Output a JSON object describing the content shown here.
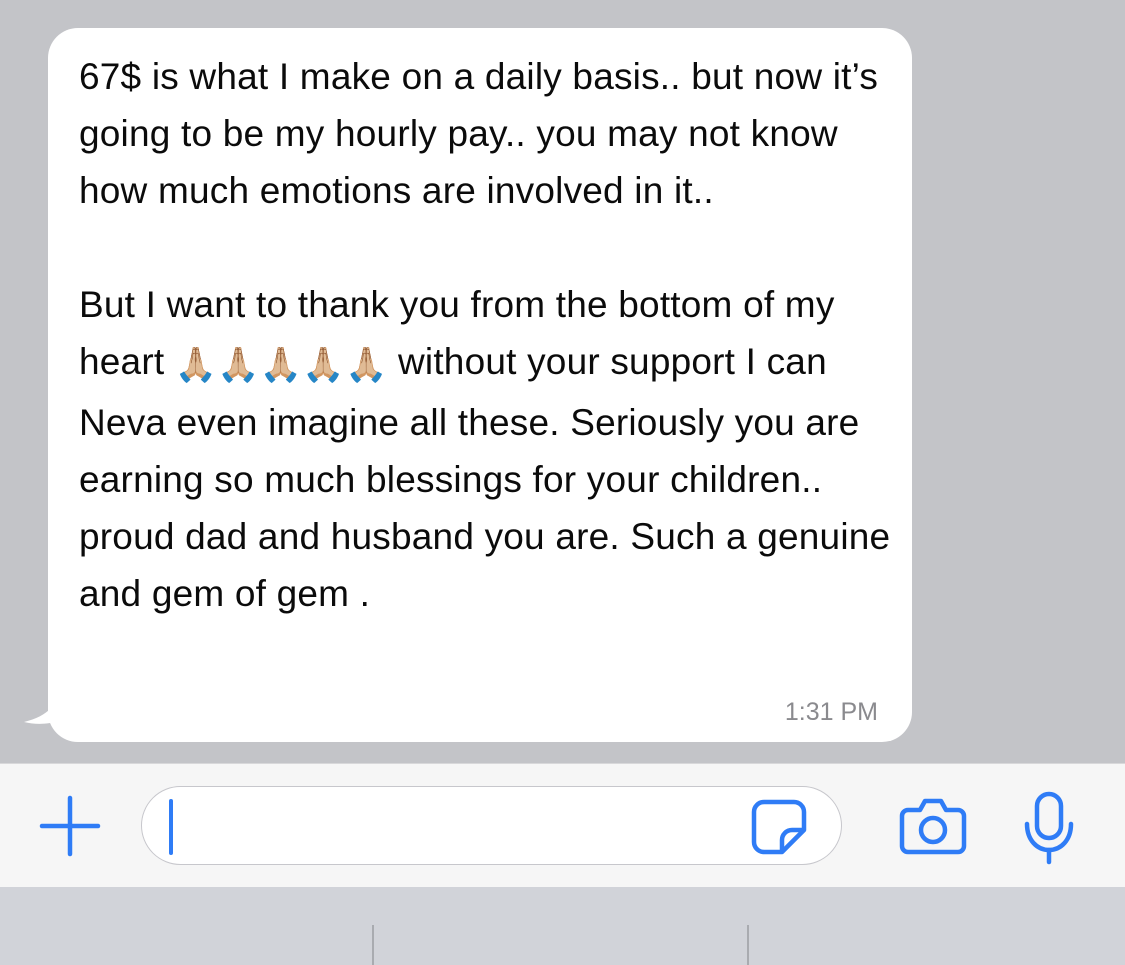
{
  "message": {
    "paragraph1": "67$ is what I make on a daily basis.. but now it’s going to be my hourly pay.. you may not know how much emotions are involved in it..",
    "paragraph2_before": "But I want to thank you from the bottom of my heart ",
    "emoji": "🙏🏼🙏🏼🙏🏼🙏🏼🙏🏼",
    "paragraph2_after": " without your support I can Neva even imagine all these. Seriously you are earning so much blessings for your children.. proud dad and husband you are. Such a genuine and gem of gem .",
    "time": "1:31 PM"
  },
  "composer": {
    "input_value": "",
    "icons": {
      "plus": "plus-icon",
      "sticker": "sticker-icon",
      "camera": "camera-icon",
      "mic": "microphone-icon"
    },
    "accent": "#2f7cf6"
  },
  "colors": {
    "chat_background": "#c3c4c8",
    "bubble": "#ffffff",
    "text": "#0b0b0b",
    "timestamp": "#8a8a8e"
  }
}
